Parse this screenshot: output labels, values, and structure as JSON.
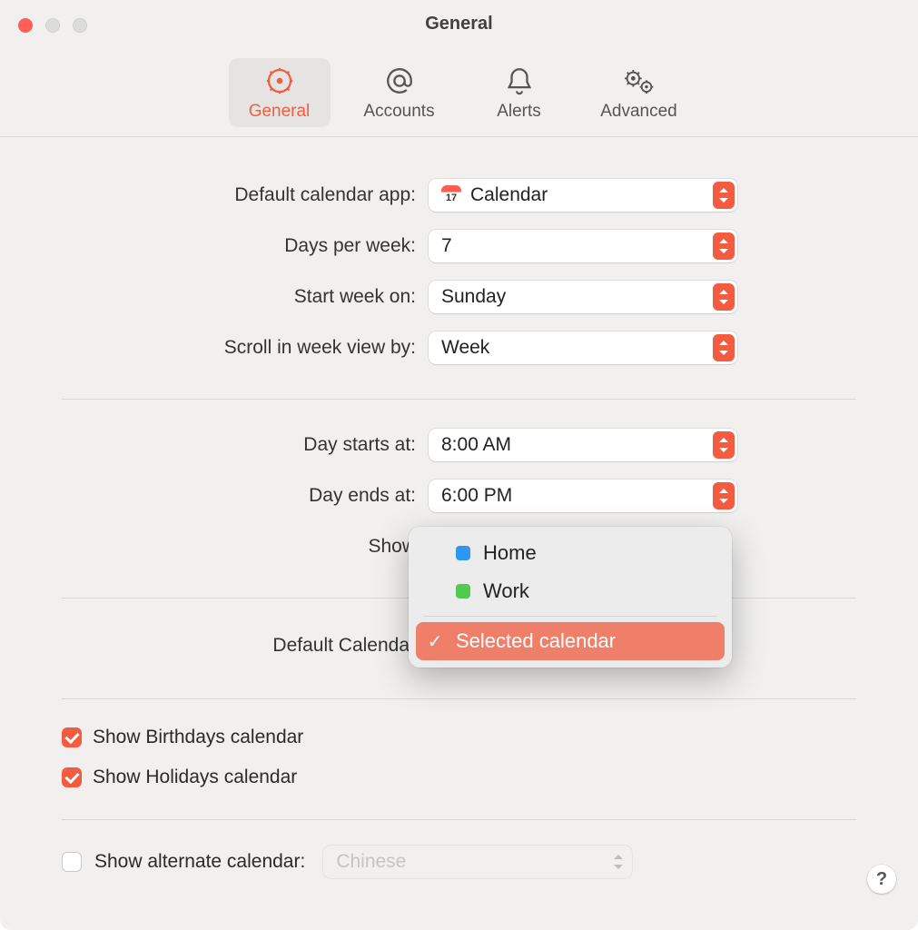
{
  "window": {
    "title": "General"
  },
  "tabs": {
    "general": "General",
    "accounts": "Accounts",
    "alerts": "Alerts",
    "advanced": "Advanced"
  },
  "labels": {
    "default_app": "Default calendar app:",
    "days_per_week": "Days per week:",
    "start_week": "Start week on:",
    "scroll_week": "Scroll in week view by:",
    "day_starts": "Day starts at:",
    "day_ends": "Day ends at:",
    "show": "Show",
    "default_calendar": "Default Calendar",
    "show_birthdays": "Show Birthdays calendar",
    "show_holidays": "Show Holidays calendar",
    "show_alternate": "Show alternate calendar:"
  },
  "values": {
    "default_app": "Calendar",
    "days_per_week": "7",
    "start_week": "Sunday",
    "scroll_week": "Week",
    "day_starts": "8:00 AM",
    "day_ends": "6:00 PM",
    "alternate": "Chinese"
  },
  "menu": {
    "item_home": "Home",
    "item_work": "Work",
    "item_selected": "Selected calendar",
    "color_home": "#2f97f0",
    "color_work": "#52c951"
  },
  "help": "?"
}
